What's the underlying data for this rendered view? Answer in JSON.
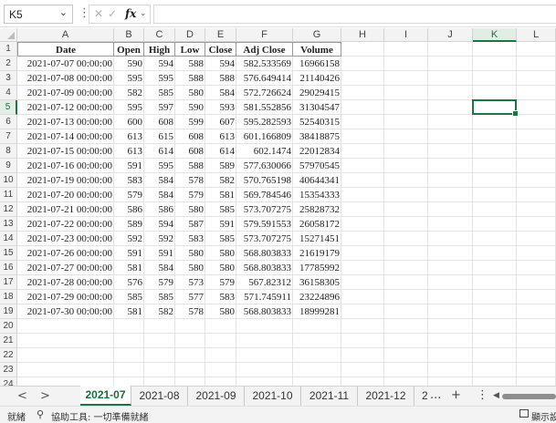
{
  "formula_bar": {
    "name_box": "K5",
    "fx_label": "fx",
    "formula": ""
  },
  "columns": [
    "A",
    "B",
    "C",
    "D",
    "E",
    "F",
    "G",
    "H",
    "I",
    "J",
    "K",
    "L"
  ],
  "selected_column": "K",
  "rows": [
    "1",
    "2",
    "3",
    "4",
    "5",
    "6",
    "7",
    "8",
    "9",
    "10",
    "11",
    "12",
    "13",
    "14",
    "15",
    "16",
    "17",
    "18",
    "19",
    "20",
    "21",
    "22",
    "23",
    "24",
    "25"
  ],
  "selected_row": "5",
  "sheet": {
    "headers": [
      "Date",
      "Open",
      "High",
      "Low",
      "Close",
      "Adj Close",
      "Volume"
    ],
    "data": [
      [
        "2021-07-07 00:00:00",
        "590",
        "594",
        "588",
        "594",
        "582.533569",
        "16966158"
      ],
      [
        "2021-07-08 00:00:00",
        "595",
        "595",
        "588",
        "588",
        "576.649414",
        "21140426"
      ],
      [
        "2021-07-09 00:00:00",
        "582",
        "585",
        "580",
        "584",
        "572.726624",
        "29029415"
      ],
      [
        "2021-07-12 00:00:00",
        "595",
        "597",
        "590",
        "593",
        "581.552856",
        "31304547"
      ],
      [
        "2021-07-13 00:00:00",
        "600",
        "608",
        "599",
        "607",
        "595.282593",
        "52540315"
      ],
      [
        "2021-07-14 00:00:00",
        "613",
        "615",
        "608",
        "613",
        "601.166809",
        "38418875"
      ],
      [
        "2021-07-15 00:00:00",
        "613",
        "614",
        "608",
        "614",
        "602.1474",
        "22012834"
      ],
      [
        "2021-07-16 00:00:00",
        "591",
        "595",
        "588",
        "589",
        "577.630066",
        "57970545"
      ],
      [
        "2021-07-19 00:00:00",
        "583",
        "584",
        "578",
        "582",
        "570.765198",
        "40644341"
      ],
      [
        "2021-07-20 00:00:00",
        "579",
        "584",
        "579",
        "581",
        "569.784546",
        "15354333"
      ],
      [
        "2021-07-21 00:00:00",
        "586",
        "586",
        "580",
        "585",
        "573.707275",
        "25828732"
      ],
      [
        "2021-07-22 00:00:00",
        "589",
        "594",
        "587",
        "591",
        "579.591553",
        "26058172"
      ],
      [
        "2021-07-23 00:00:00",
        "592",
        "592",
        "583",
        "585",
        "573.707275",
        "15271451"
      ],
      [
        "2021-07-26 00:00:00",
        "591",
        "591",
        "580",
        "580",
        "568.803833",
        "21619179"
      ],
      [
        "2021-07-27 00:00:00",
        "581",
        "584",
        "580",
        "580",
        "568.803833",
        "17785992"
      ],
      [
        "2021-07-28 00:00:00",
        "576",
        "579",
        "573",
        "579",
        "567.82312",
        "36158305"
      ],
      [
        "2021-07-29 00:00:00",
        "585",
        "585",
        "577",
        "583",
        "571.745911",
        "23224896"
      ],
      [
        "2021-07-30 00:00:00",
        "581",
        "582",
        "578",
        "580",
        "568.803833",
        "18999281"
      ]
    ]
  },
  "tabs": [
    "2021-07",
    "2021-08",
    "2021-09",
    "2021-10",
    "2021-11",
    "2021-12",
    "2"
  ],
  "active_tab": "2021-07",
  "tab_bar": {
    "prev": "<",
    "next": ">",
    "more": "...",
    "add": "+",
    "options": "⋮"
  },
  "status": {
    "ready": "就緒",
    "accessibility": "協助工具: 一切準備就緒",
    "display": "顯示設"
  },
  "colors": {
    "accent": "#217346"
  }
}
